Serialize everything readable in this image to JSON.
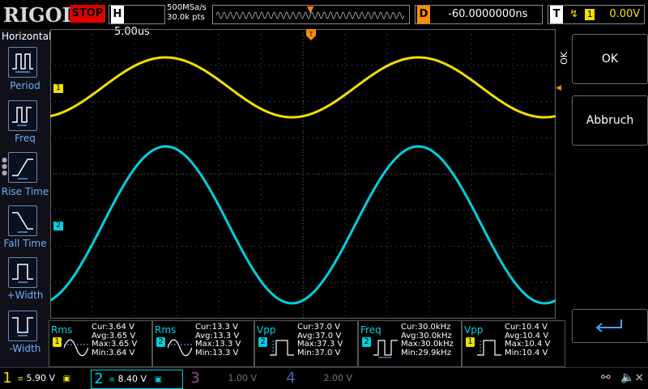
{
  "header": {
    "logo": "RIGOL",
    "run_state": "STOP",
    "timebase_key": "H",
    "timebase_value": "5.00us",
    "sample_rate": "500MSa/s",
    "mem_depth": "30.0k pts",
    "delay_key": "D",
    "delay_value": "-60.0000000ns",
    "trigger_key": "T",
    "trigger_source": "1",
    "trigger_level": "0.00V"
  },
  "left_menu": {
    "title": "Horizontal",
    "items": [
      {
        "label": "Period",
        "icon": "period-icon"
      },
      {
        "label": "Freq",
        "icon": "freq-icon"
      },
      {
        "label": "Rise Time",
        "icon": "rise-time-icon"
      },
      {
        "label": "Fall Time",
        "icon": "fall-time-icon"
      },
      {
        "label": "+Width",
        "icon": "positive-width-icon"
      },
      {
        "label": "-Width",
        "icon": "negative-width-icon"
      }
    ]
  },
  "right_menu": {
    "ok_label": "OK",
    "cancel_label": "Abbruch",
    "side_label": "OK"
  },
  "channel_markers": {
    "ch1": "1",
    "ch2": "2"
  },
  "measurements": [
    {
      "name": "Rms",
      "channel": "1",
      "cur": "Cur:3.64 V",
      "avg": "Avg:3.65 V",
      "max": "Max:3.65 V",
      "min": "Min:3.64 V"
    },
    {
      "name": "Rms",
      "channel": "2",
      "cur": "Cur:13.3 V",
      "avg": "Avg:13.3 V",
      "max": "Max:13.3 V",
      "min": "Min:13.3 V"
    },
    {
      "name": "Vpp",
      "channel": "2",
      "cur": "Cur:37.0 V",
      "avg": "Avg:37.0 V",
      "max": "Max:37.3 V",
      "min": "Min:37.0 V"
    },
    {
      "name": "Freq",
      "channel": "2",
      "cur": "Cur:30.0kHz",
      "avg": "Avg:30.0kHz",
      "max": "Max:30.0kHz",
      "min": "Min:29.9kHz"
    },
    {
      "name": "Vpp",
      "channel": "1",
      "cur": "Cur:10.4 V",
      "avg": "Avg:10.4 V",
      "max": "Max:10.4 V",
      "min": "Min:10.4 V"
    }
  ],
  "bottom": {
    "channels": [
      {
        "num": "1",
        "scale": "5.90 V"
      },
      {
        "num": "2",
        "scale": "8.40 V"
      },
      {
        "num": "3",
        "scale": "1.00 V"
      },
      {
        "num": "4",
        "scale": "2.00 V"
      }
    ]
  },
  "colors": {
    "ch1": "#f0e000",
    "ch2": "#00d0e0",
    "trigger": "#ff8c00",
    "stop": "#e00000"
  }
}
